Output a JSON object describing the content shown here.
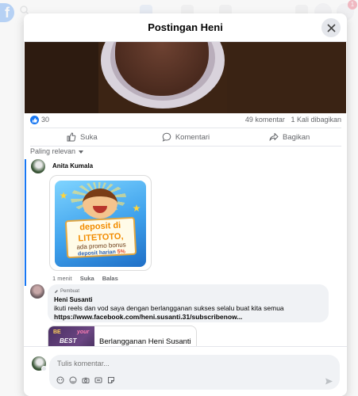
{
  "background": {
    "notification_count": "1"
  },
  "modal": {
    "title": "Postingan Heni"
  },
  "post": {
    "like_count": "30",
    "comment_count": "49 komentar",
    "share_count": "1 Kali dibagikan",
    "actions": {
      "like": "Suka",
      "comment": "Komentari",
      "share": "Bagikan"
    },
    "sort_label": "Paling relevan"
  },
  "comments": [
    {
      "author": "Anita Kumala",
      "sticker_text": {
        "line1": "deposit di",
        "line2": "LITETOTO,",
        "line3": "ada promo bonus",
        "line4": "deposit harian",
        "line5": "5%"
      },
      "time": "1 menit",
      "like_label": "Suka",
      "reply_label": "Balas"
    },
    {
      "author_tag": "Pembuat",
      "author": "Heni Susanti",
      "text": "ikuti reels dan vod saya dengan berlangganan sukses selalu buat kita semua",
      "link": "https://www.facebook.com/heni.susanti.31/subscribenow...",
      "link_card": {
        "thumb_text1": "BE",
        "thumb_text2": "your",
        "thumb_text3": "BEST",
        "title": "Berlangganan Heni Susanti"
      }
    }
  ],
  "composer": {
    "placeholder": "Tulis komentar..."
  },
  "colors": {
    "accent": "#1877f2",
    "bubble": "#f0f2f5",
    "muted_text": "#65676b"
  }
}
